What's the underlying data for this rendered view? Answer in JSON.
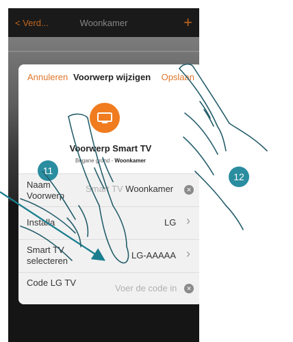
{
  "topbar": {
    "back_label": "< Verd...",
    "title": "Woonkamer",
    "add_label": "+"
  },
  "dialog": {
    "cancel_label": "Annuleren",
    "title": "Voorwerp wijzigen",
    "save_label": "Opslaan",
    "object_name": "Voorwerp Smart TV",
    "location_floor": "Begane grond - ",
    "location_room": "Woonkamer",
    "fields": {
      "name_label": "Naam Voorwerp",
      "name_value_prefix": "Smart TV ",
      "name_value": "Woonkamer",
      "install_label": "Installa",
      "install_value": "LG",
      "select_label": "Smart TV selecteren",
      "select_value": "LG-AAAAA",
      "code_label": "Code LG TV",
      "code_placeholder": "Voer de code in"
    }
  },
  "steps": {
    "step_11": "11",
    "step_12": "12"
  },
  "colors": {
    "accent": "#e0762a",
    "step_badge": "#2a8da0",
    "tv_icon_bg": "#f07c1f"
  },
  "icons": [
    "tv-icon",
    "clear-icon",
    "chevron-right-icon",
    "hand-pointer-icon",
    "arrow-icon"
  ]
}
